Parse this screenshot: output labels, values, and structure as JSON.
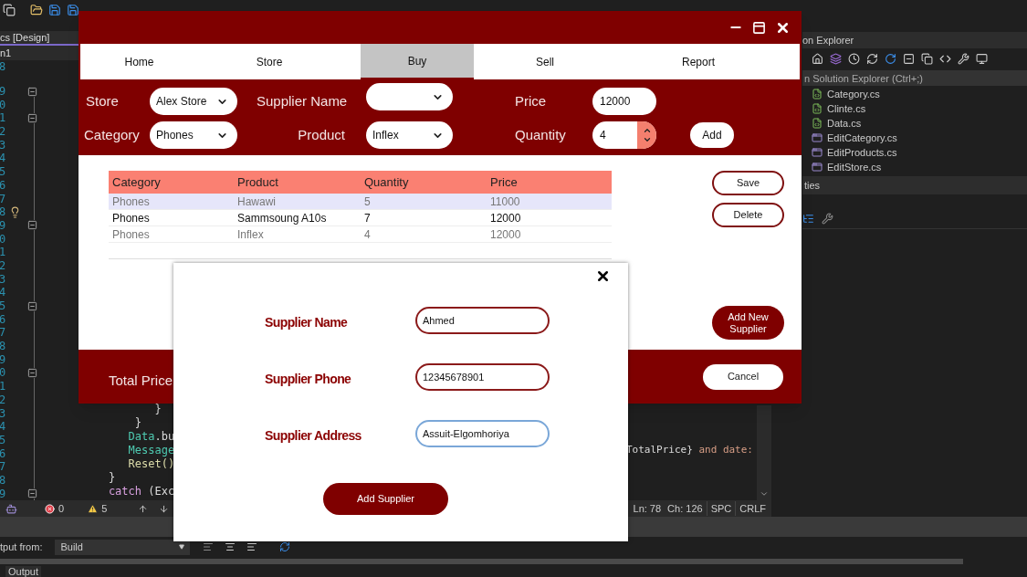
{
  "ide": {
    "design_tab": "cs [Design]",
    "form_selector": "n1",
    "gutter": [
      {
        "number": "8"
      },
      {
        "number": "9",
        "kind": "collapse"
      },
      {
        "number": "0"
      },
      {
        "number": "1",
        "kind": "collapse"
      },
      {
        "number": "2"
      },
      {
        "number": "3"
      },
      {
        "number": "4"
      },
      {
        "number": "5"
      },
      {
        "number": "6"
      },
      {
        "number": "7"
      },
      {
        "number": "8",
        "kind": "lightbulb"
      },
      {
        "number": "9",
        "kind": "collapse"
      },
      {
        "number": "0"
      },
      {
        "number": "1"
      },
      {
        "number": "2"
      },
      {
        "number": "3"
      },
      {
        "number": "4"
      },
      {
        "number": "5",
        "kind": "collapse"
      },
      {
        "number": "6"
      },
      {
        "number": "7"
      },
      {
        "number": "8"
      },
      {
        "number": "9"
      },
      {
        "number": "0",
        "kind": "collapse"
      },
      {
        "number": "1"
      },
      {
        "number": "2"
      },
      {
        "number": "3"
      },
      {
        "number": "4"
      },
      {
        "number": "5"
      },
      {
        "number": "6"
      },
      {
        "number": "7"
      },
      {
        "number": "8"
      },
      {
        "number": "9",
        "kind": "collapse"
      }
    ],
    "code_lines": [
      {
        "left": [
          {
            "text": "           }",
            "kind": "plain"
          }
        ]
      },
      {
        "left": [
          {
            "text": "        }",
            "kind": "plain"
          }
        ]
      },
      {
        "left": [
          {
            "text": "       Data",
            "kind": "type"
          },
          {
            "text": ".bu",
            "kind": "plain"
          }
        ]
      },
      {
        "left": [
          {
            "text": "       Message",
            "kind": "type"
          }
        ],
        "right": [
          {
            "text": "TotalPrice}",
            "kind": "plain"
          },
          {
            "text": " and date:",
            "kind": "string"
          }
        ]
      },
      {
        "left": [
          {
            "text": "       Reset()",
            "kind": "method"
          }
        ]
      },
      {
        "left": [
          {
            "text": "    }",
            "kind": "plain"
          }
        ]
      },
      {
        "left": [
          {
            "text": "    catch",
            "kind": "keyword"
          },
          {
            "text": " (Exc",
            "kind": "plain"
          }
        ]
      }
    ],
    "status_bar": {
      "errors": "0",
      "warnings": "5",
      "line": "Ln: 78",
      "column": "Ch: 126",
      "indent": "SPC",
      "line_ending": "CRLF"
    },
    "solution_explorer": {
      "title": "on Explorer",
      "search_placeholder": "n Solution Explorer (Ctrl+;)",
      "files": [
        {
          "name": "Category.cs",
          "kind": "code"
        },
        {
          "name": "Clinte.cs",
          "kind": "code"
        },
        {
          "name": "Data.cs",
          "kind": "code"
        },
        {
          "name": "EditCategory.cs",
          "kind": "form"
        },
        {
          "name": "EditProducts.cs",
          "kind": "form"
        },
        {
          "name": "EditStore.cs",
          "kind": "form"
        }
      ],
      "properties_title": "ties"
    },
    "output": {
      "label": "tput from:",
      "source": "Build",
      "tab": "Output"
    }
  },
  "app": {
    "tabs": [
      {
        "label": "Home",
        "selected": false
      },
      {
        "label": "Store",
        "selected": false
      },
      {
        "label": "Buy",
        "selected": true
      },
      {
        "label": "Sell",
        "selected": false
      },
      {
        "label": "Report",
        "selected": false
      }
    ],
    "form": {
      "store": {
        "label": "Store",
        "value": "Alex Store"
      },
      "supplier_name": {
        "label": "Supplier Name"
      },
      "price": {
        "label": "Price",
        "value": "12000"
      },
      "category": {
        "label": "Category",
        "value": "Phones"
      },
      "product": {
        "label": "Product",
        "value": "Inflex"
      },
      "quantity": {
        "label": "Quantity",
        "value": "4"
      },
      "add_button": "Add"
    },
    "table": {
      "columns": [
        "Category",
        "Product",
        "Quantity",
        "Price"
      ],
      "rows": [
        {
          "cells": [
            "Phones",
            "Hawawi",
            "5",
            "11000"
          ],
          "selected": true,
          "dimmed": true
        },
        {
          "cells": [
            "Phones",
            "Sammsoung A10s",
            "7",
            "12000"
          ],
          "selected": false,
          "dimmed": false
        },
        {
          "cells": [
            "Phones",
            "Inflex",
            "4",
            "12000"
          ],
          "selected": false,
          "dimmed": true
        }
      ]
    },
    "buttons": {
      "save": "Save",
      "delete": "Delete",
      "add_new_supplier": "Add New Supplier"
    },
    "footer": {
      "total_price_label": "Total Price",
      "cancel": "Cancel"
    }
  },
  "dialog": {
    "fields": [
      {
        "label": "Supplier Name",
        "value": "Ahmed",
        "focused": false
      },
      {
        "label": "Supplier Phone",
        "value": "12345678901",
        "focused": false
      },
      {
        "label": "Supplier Address",
        "value": "Assuit-Elgomhoriya",
        "focused": true
      }
    ],
    "submit": "Add Supplier"
  }
}
